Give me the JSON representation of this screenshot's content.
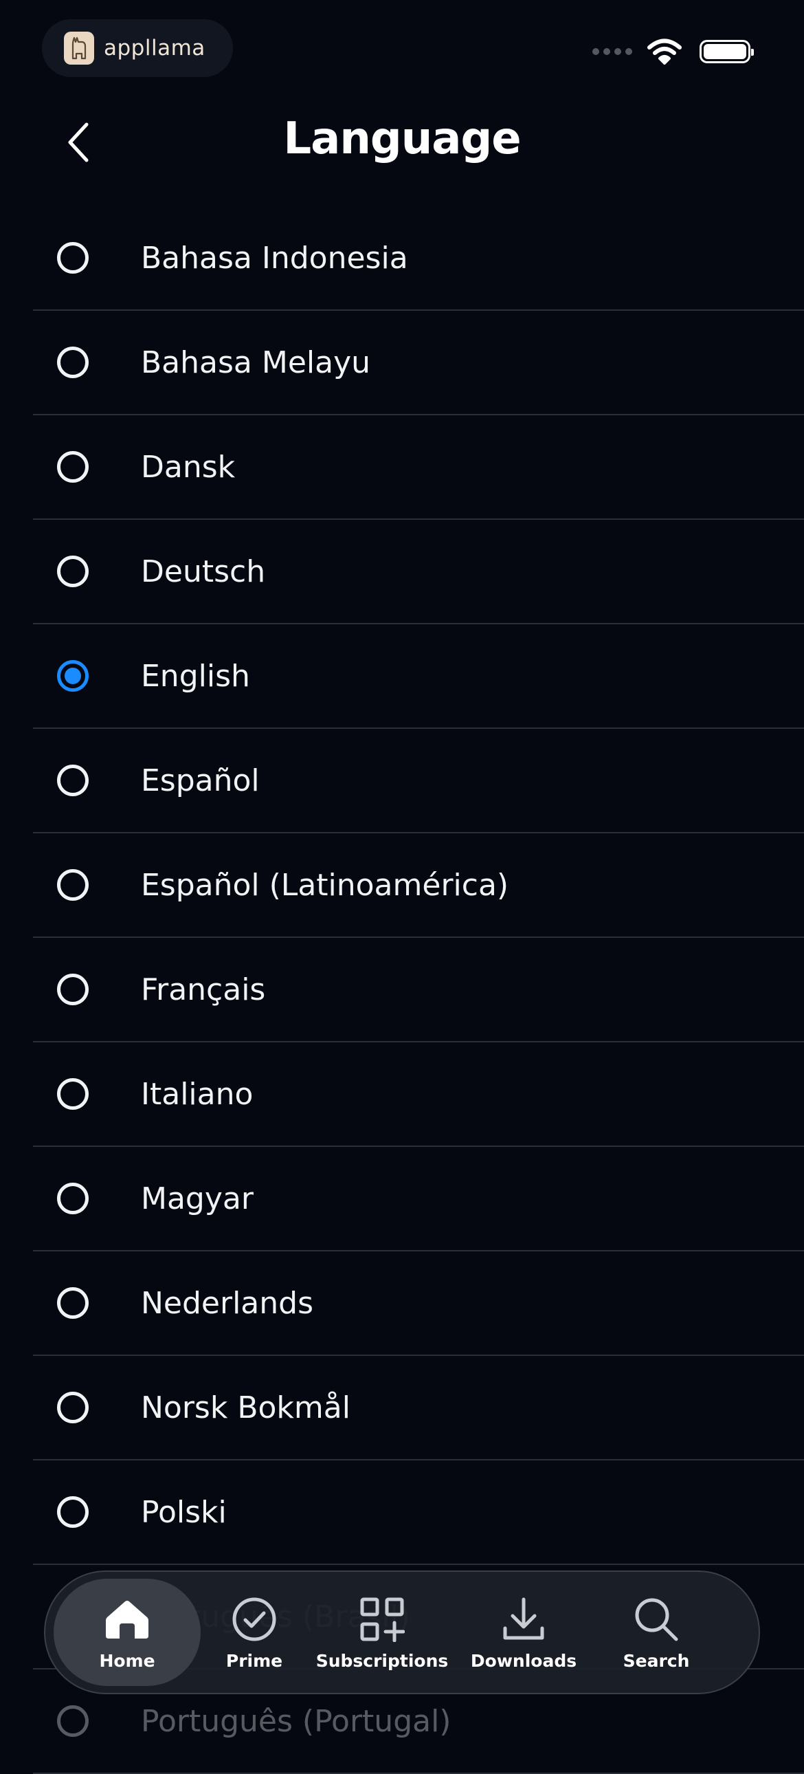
{
  "status_bar": {
    "brand_name": "appllama"
  },
  "header": {
    "title": "Language"
  },
  "languages": [
    {
      "label": "Bahasa Indonesia",
      "selected": false
    },
    {
      "label": "Bahasa Melayu",
      "selected": false
    },
    {
      "label": "Dansk",
      "selected": false
    },
    {
      "label": "Deutsch",
      "selected": false
    },
    {
      "label": "English",
      "selected": true
    },
    {
      "label": "Español",
      "selected": false
    },
    {
      "label": "Español (Latinoamérica)",
      "selected": false
    },
    {
      "label": "Français",
      "selected": false
    },
    {
      "label": "Italiano",
      "selected": false
    },
    {
      "label": "Magyar",
      "selected": false
    },
    {
      "label": "Nederlands",
      "selected": false
    },
    {
      "label": "Norsk Bokmål",
      "selected": false
    },
    {
      "label": "Polski",
      "selected": false
    },
    {
      "label": "Português (Brasil)",
      "selected": false
    },
    {
      "label": "Português (Portugal)",
      "selected": false
    }
  ],
  "bottom_nav": {
    "items": [
      {
        "label": "Home",
        "icon": "home-icon",
        "active": true
      },
      {
        "label": "Prime",
        "icon": "check-circle-icon",
        "active": false
      },
      {
        "label": "Subscriptions",
        "icon": "grid-plus-icon",
        "active": false
      },
      {
        "label": "Downloads",
        "icon": "download-icon",
        "active": false
      },
      {
        "label": "Search",
        "icon": "search-icon",
        "active": false
      }
    ]
  },
  "colors": {
    "background": "#050811",
    "accent": "#1a8cff",
    "divider": "#2b2f38"
  }
}
